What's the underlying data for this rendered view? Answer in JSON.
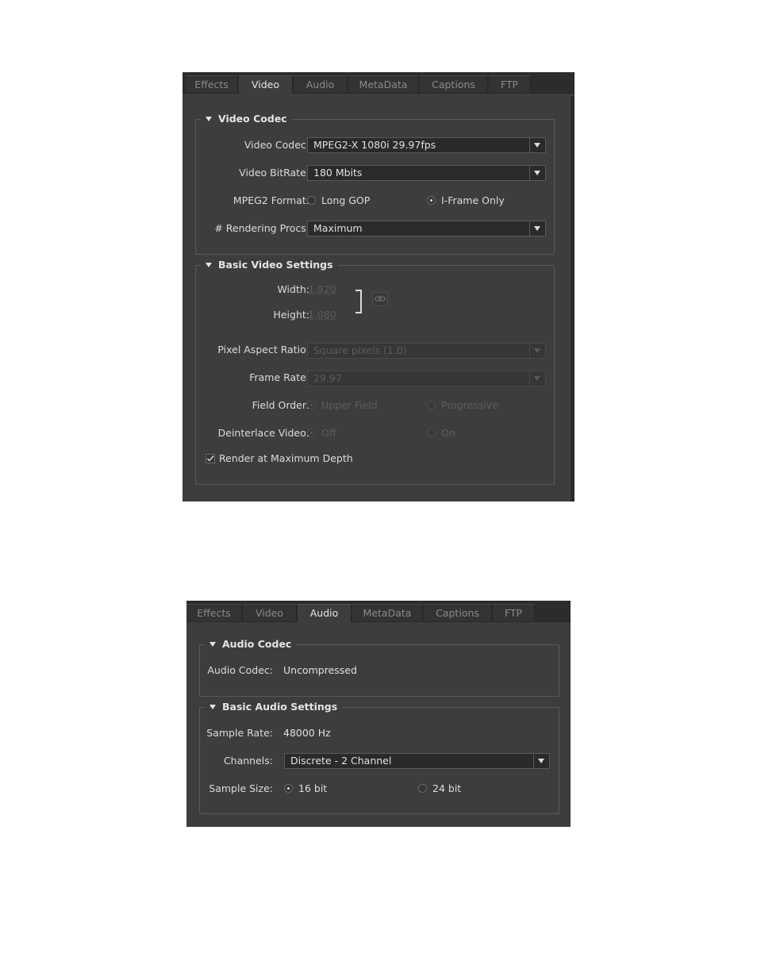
{
  "video_panel": {
    "tabs": [
      "Effects",
      "Video",
      "Audio",
      "MetaData",
      "Captions",
      "FTP"
    ],
    "active_tab": "Video",
    "video_codec_group": {
      "title": "Video Codec",
      "codec_label": "Video Codec:",
      "codec_value": "MPEG2-X 1080i 29.97fps",
      "bitrate_label": "Video BitRate:",
      "bitrate_value": "180 Mbits",
      "format_label": "MPEG2 Format:",
      "format_options": [
        "Long GOP",
        "I-Frame Only"
      ],
      "format_selected": "I-Frame Only",
      "procs_label": "# Rendering Procs:",
      "procs_value": "Maximum"
    },
    "basic_video_group": {
      "title": "Basic Video Settings",
      "width_label": "Width:",
      "width_value": "1,920",
      "height_label": "Height:",
      "height_value": "1,080",
      "par_label": "Pixel Aspect Ratio:",
      "par_value": "Square pixels (1.0)",
      "framerate_label": "Frame Rate:",
      "framerate_value": "29.97",
      "field_order_label": "Field Order:",
      "field_order_options": [
        "Upper Field",
        "Progressive"
      ],
      "field_order_selected": "Upper Field",
      "deinterlace_label": "Deinterlace Video:",
      "deinterlace_options": [
        "Off",
        "On"
      ],
      "deinterlace_selected": "Off",
      "render_max_depth_label": "Render at Maximum Depth",
      "render_max_depth_checked": true
    }
  },
  "audio_panel": {
    "tabs": [
      "Effects",
      "Video",
      "Audio",
      "MetaData",
      "Captions",
      "FTP"
    ],
    "active_tab": "Audio",
    "audio_codec_group": {
      "title": "Audio Codec",
      "codec_label": "Audio Codec:",
      "codec_value": "Uncompressed"
    },
    "basic_audio_group": {
      "title": "Basic Audio Settings",
      "sample_rate_label": "Sample Rate:",
      "sample_rate_value": "48000 Hz",
      "channels_label": "Channels:",
      "channels_value": "Discrete - 2 Channel",
      "sample_size_label": "Sample Size:",
      "sample_size_options": [
        "16 bit",
        "24 bit"
      ],
      "sample_size_selected": "16 bit"
    }
  },
  "colors": {
    "panel_bg": "#3d3d3d",
    "tabbar_bg": "#2c2c2c",
    "field_bg": "#2a2a2a",
    "text": "#dcdcdc",
    "disabled_text": "#5c5c5c"
  }
}
